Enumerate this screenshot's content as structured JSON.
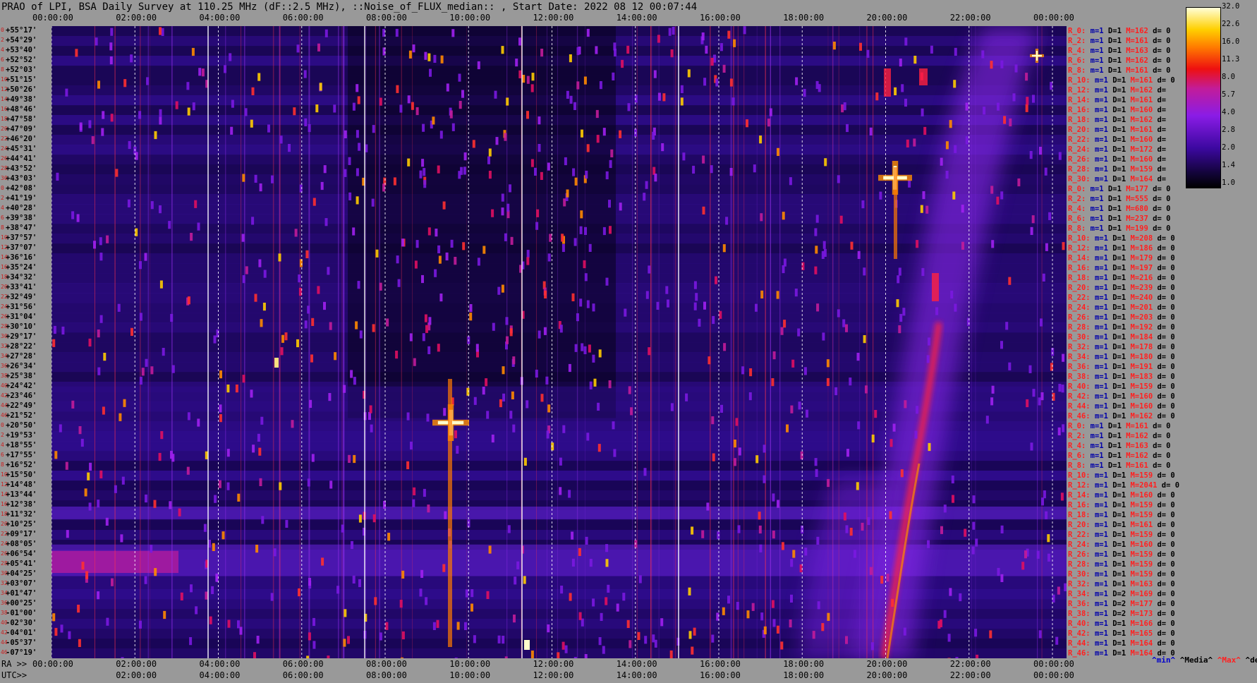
{
  "title": "PRAO of LPI, BSA Daily Survey at 110.25 MHz (dF::2.5 MHz), ::Noise_of_FLUX_median:: , Start Date: 2022 08 12 00:07:44",
  "colors": {
    "background": "#999999",
    "accent": "#ff2020"
  },
  "chart_data": {
    "type": "heatmap",
    "title": "PRAO of LPI, BSA Daily Survey at 110.25 MHz (dF::2.5 MHz), ::Noise_of_FLUX_median:: , Start Date: 2022 08 12 00:07:44",
    "x_axis": {
      "top_ticks": [
        "00:00:00",
        "02:00:00",
        "04:00:00",
        "06:00:00",
        "08:00:00",
        "10:00:00",
        "12:00:00",
        "14:00:00",
        "16:00:00",
        "18:00:00",
        "20:00:00",
        "22:00:00",
        "00:00:00"
      ],
      "bottom_ra_prefix": "RA >>",
      "bottom_ra_ticks": [
        "00:00:00",
        "02:00:00",
        "04:00:00",
        "06:00:00",
        "08:00:00",
        "10:00:00",
        "12:00:00",
        "14:00:00",
        "16:00:00",
        "18:00:00",
        "20:00:00",
        "22:00:00",
        "00:00:00"
      ],
      "bottom_utc_prefix": "UTC>>",
      "bottom_utc_ticks": [
        "02:00:00",
        "04:00:00",
        "06:00:00",
        "08:00:00",
        "10:00:00",
        "12:00:00",
        "14:00:00",
        "16:00:00",
        "18:00:00",
        "20:00:00",
        "22:00:00",
        "00:00:00"
      ]
    },
    "y_axis": {
      "declinations": [
        "+55°17'",
        "+54°29'",
        "+53°40'",
        "+52°52'",
        "+52°03'",
        "+51°15'",
        "+50°26'",
        "+49°38'",
        "+48°46'",
        "+47°58'",
        "+47°09'",
        "+46°20'",
        "+45°31'",
        "+44°41'",
        "+43°52'",
        "+43°03'",
        "+42°08'",
        "+41°19'",
        "+40°28'",
        "+39°38'",
        "+38°47'",
        "+37°57'",
        "+37°07'",
        "+36°16'",
        "+35°24'",
        "+34°32'",
        "+33°41'",
        "+32°49'",
        "+31°56'",
        "+31°04'",
        "+30°10'",
        "+29°17'",
        "+28°22'",
        "+27°28'",
        "+26°34'",
        "+25°38'",
        "+24°42'",
        "+23°46'",
        "+22°49'",
        "+21°52'",
        "+20°50'",
        "+19°53'",
        "+18°55'",
        "+17°55'",
        "+16°52'",
        "+15°50'",
        "+14°48'",
        "+13°44'",
        "+12°38'",
        "+11°32'",
        "+10°25'",
        "+09°17'",
        "+08°05'",
        "+06°54'",
        "+05°41'",
        "+04°25'",
        "+03°07'",
        "+01°47'",
        "+00°25'",
        "-01°00'",
        "-02°30'",
        "-04°01'",
        "-05°37'",
        "-07°19'"
      ],
      "ray_index": [
        "0",
        "2",
        "4",
        "6",
        "8",
        "10",
        "12",
        "14",
        "16",
        "18",
        "20",
        "22",
        "24",
        "26",
        "28",
        "30",
        "0",
        "2",
        "4",
        "6",
        "8",
        "10",
        "12",
        "14",
        "16",
        "18",
        "20",
        "22",
        "24",
        "26",
        "28",
        "30",
        "32",
        "34",
        "36",
        "38",
        "40",
        "42",
        "44",
        "46",
        "0",
        "2",
        "4",
        "6",
        "8",
        "10",
        "12",
        "14",
        "16",
        "18",
        "20",
        "22",
        "24",
        "26",
        "28",
        "30",
        "32",
        "34",
        "36",
        "38",
        "40",
        "42",
        "44",
        "46"
      ]
    },
    "colorbar": {
      "scale": "log",
      "ticks": [
        "32.0",
        "22.6",
        "16.0",
        "11.3",
        "8.0",
        "5.7",
        "4.0",
        "2.8",
        "2.0",
        "1.4",
        "1.0"
      ],
      "range": [
        1.0,
        32.0
      ]
    },
    "ray_stats": [
      {
        "r": "R_0:",
        "m": "m=1",
        "d": "D=1",
        "M": "M=162",
        "dev": "d= 0"
      },
      {
        "r": "R_2:",
        "m": "m=1",
        "d": "D=1",
        "M": "M=161",
        "dev": "d= 0"
      },
      {
        "r": "R_4:",
        "m": "m=1",
        "d": "D=1",
        "M": "M=163",
        "dev": "d= 0"
      },
      {
        "r": "R_6:",
        "m": "m=1",
        "d": "D=1",
        "M": "M=162",
        "dev": "d= 0"
      },
      {
        "r": "R_8:",
        "m": "m=1",
        "d": "D=1",
        "M": "M=161",
        "dev": "d= 0"
      },
      {
        "r": "R_10:",
        "m": "m=1",
        "d": "D=1",
        "M": "M=161",
        "dev": "d= 0"
      },
      {
        "r": "R_12:",
        "m": "m=1",
        "d": "D=1",
        "M": "M=162",
        "dev": "d="
      },
      {
        "r": "R_14:",
        "m": "m=1",
        "d": "D=1",
        "M": "M=161",
        "dev": "d="
      },
      {
        "r": "R_16:",
        "m": "m=1",
        "d": "D=1",
        "M": "M=160",
        "dev": "d="
      },
      {
        "r": "R_18:",
        "m": "m=1",
        "d": "D=1",
        "M": "M=162",
        "dev": "d="
      },
      {
        "r": "R_20:",
        "m": "m=1",
        "d": "D=1",
        "M": "M=161",
        "dev": "d="
      },
      {
        "r": "R_22:",
        "m": "m=1",
        "d": "D=1",
        "M": "M=160",
        "dev": "d="
      },
      {
        "r": "R_24:",
        "m": "m=1",
        "d": "D=1",
        "M": "M=172",
        "dev": "d="
      },
      {
        "r": "R_26:",
        "m": "m=1",
        "d": "D=1",
        "M": "M=160",
        "dev": "d="
      },
      {
        "r": "R_28:",
        "m": "m=1",
        "d": "D=1",
        "M": "M=159",
        "dev": "d="
      },
      {
        "r": "R_30:",
        "m": "m=1",
        "d": "D=1",
        "M": "M=164",
        "dev": "d="
      },
      {
        "r": "R_0:",
        "m": "m=1",
        "d": "D=1",
        "M": "M=177",
        "dev": "d= 0"
      },
      {
        "r": "R_2:",
        "m": "m=1",
        "d": "D=1",
        "M": "M=555",
        "dev": "d= 0"
      },
      {
        "r": "R_4:",
        "m": "m=1",
        "d": "D=1",
        "M": "M=680",
        "dev": "d= 0"
      },
      {
        "r": "R_6:",
        "m": "m=1",
        "d": "D=1",
        "M": "M=237",
        "dev": "d= 0"
      },
      {
        "r": "R_8:",
        "m": "m=1",
        "d": "D=1",
        "M": "M=199",
        "dev": "d= 0"
      },
      {
        "r": "R_10:",
        "m": "m=1",
        "d": "D=1",
        "M": "M=208",
        "dev": "d= 0"
      },
      {
        "r": "R_12:",
        "m": "m=1",
        "d": "D=1",
        "M": "M=186",
        "dev": "d= 0"
      },
      {
        "r": "R_14:",
        "m": "m=1",
        "d": "D=1",
        "M": "M=179",
        "dev": "d= 0"
      },
      {
        "r": "R_16:",
        "m": "m=1",
        "d": "D=1",
        "M": "M=197",
        "dev": "d= 0"
      },
      {
        "r": "R_18:",
        "m": "m=1",
        "d": "D=1",
        "M": "M=216",
        "dev": "d= 0"
      },
      {
        "r": "R_20:",
        "m": "m=1",
        "d": "D=1",
        "M": "M=239",
        "dev": "d= 0"
      },
      {
        "r": "R_22:",
        "m": "m=1",
        "d": "D=1",
        "M": "M=240",
        "dev": "d= 0"
      },
      {
        "r": "R_24:",
        "m": "m=1",
        "d": "D=1",
        "M": "M=201",
        "dev": "d= 0"
      },
      {
        "r": "R_26:",
        "m": "m=1",
        "d": "D=1",
        "M": "M=203",
        "dev": "d= 0"
      },
      {
        "r": "R_28:",
        "m": "m=1",
        "d": "D=1",
        "M": "M=192",
        "dev": "d= 0"
      },
      {
        "r": "R_30:",
        "m": "m=1",
        "d": "D=1",
        "M": "M=184",
        "dev": "d= 0"
      },
      {
        "r": "R_32:",
        "m": "m=1",
        "d": "D=1",
        "M": "M=178",
        "dev": "d= 0"
      },
      {
        "r": "R_34:",
        "m": "m=1",
        "d": "D=1",
        "M": "M=180",
        "dev": "d= 0"
      },
      {
        "r": "R_36:",
        "m": "m=1",
        "d": "D=1",
        "M": "M=191",
        "dev": "d= 0"
      },
      {
        "r": "R_38:",
        "m": "m=1",
        "d": "D=1",
        "M": "M=183",
        "dev": "d= 0"
      },
      {
        "r": "R_40:",
        "m": "m=1",
        "d": "D=1",
        "M": "M=159",
        "dev": "d= 0"
      },
      {
        "r": "R_42:",
        "m": "m=1",
        "d": "D=1",
        "M": "M=160",
        "dev": "d= 0"
      },
      {
        "r": "R_44:",
        "m": "m=1",
        "d": "D=1",
        "M": "M=160",
        "dev": "d= 0"
      },
      {
        "r": "R_46:",
        "m": "m=1",
        "d": "D=1",
        "M": "M=162",
        "dev": "d= 0"
      },
      {
        "r": "R_0:",
        "m": "m=1",
        "d": "D=1",
        "M": "M=161",
        "dev": "d= 0"
      },
      {
        "r": "R_2:",
        "m": "m=1",
        "d": "D=1",
        "M": "M=162",
        "dev": "d= 0"
      },
      {
        "r": "R_4:",
        "m": "m=1",
        "d": "D=1",
        "M": "M=163",
        "dev": "d= 0"
      },
      {
        "r": "R_6:",
        "m": "m=1",
        "d": "D=1",
        "M": "M=162",
        "dev": "d= 0"
      },
      {
        "r": "R_8:",
        "m": "m=1",
        "d": "D=1",
        "M": "M=161",
        "dev": "d= 0"
      },
      {
        "r": "R_10:",
        "m": "m=1",
        "d": "D=1",
        "M": "M=159",
        "dev": "d= 0"
      },
      {
        "r": "R_12:",
        "m": "m=1",
        "d": "D=1",
        "M": "M=2041",
        "dev": "d= 0"
      },
      {
        "r": "R_14:",
        "m": "m=1",
        "d": "D=1",
        "M": "M=160",
        "dev": "d= 0"
      },
      {
        "r": "R_16:",
        "m": "m=1",
        "d": "D=1",
        "M": "M=159",
        "dev": "d= 0"
      },
      {
        "r": "R_18:",
        "m": "m=1",
        "d": "D=1",
        "M": "M=159",
        "dev": "d= 0"
      },
      {
        "r": "R_20:",
        "m": "m=1",
        "d": "D=1",
        "M": "M=161",
        "dev": "d= 0"
      },
      {
        "r": "R_22:",
        "m": "m=1",
        "d": "D=1",
        "M": "M=159",
        "dev": "d= 0"
      },
      {
        "r": "R_24:",
        "m": "m=1",
        "d": "D=1",
        "M": "M=160",
        "dev": "d= 0"
      },
      {
        "r": "R_26:",
        "m": "m=1",
        "d": "D=1",
        "M": "M=159",
        "dev": "d= 0"
      },
      {
        "r": "R_28:",
        "m": "m=1",
        "d": "D=1",
        "M": "M=159",
        "dev": "d= 0"
      },
      {
        "r": "R_30:",
        "m": "m=1",
        "d": "D=1",
        "M": "M=159",
        "dev": "d= 0"
      },
      {
        "r": "R_32:",
        "m": "m=1",
        "d": "D=1",
        "M": "M=163",
        "dev": "d= 0"
      },
      {
        "r": "R_34:",
        "m": "m=1",
        "d": "D=2",
        "M": "M=169",
        "dev": "d= 0"
      },
      {
        "r": "R_36:",
        "m": "m=1",
        "d": "D=2",
        "M": "M=177",
        "dev": "d= 0"
      },
      {
        "r": "R_38:",
        "m": "m=1",
        "d": "D=2",
        "M": "M=173",
        "dev": "d= 0"
      },
      {
        "r": "R_40:",
        "m": "m=1",
        "d": "D=1",
        "M": "M=166",
        "dev": "d= 0"
      },
      {
        "r": "R_42:",
        "m": "m=1",
        "d": "D=1",
        "M": "M=165",
        "dev": "d= 0"
      },
      {
        "r": "R_44:",
        "m": "m=1",
        "d": "D=1",
        "M": "M=164",
        "dev": "d= 0"
      },
      {
        "r": "R_46:",
        "m": "m=1",
        "d": "D=1",
        "M": "M=164",
        "dev": "d= 0"
      }
    ],
    "legend": [
      "^min^",
      "^Media^",
      "^Max^",
      "^devia^"
    ]
  }
}
